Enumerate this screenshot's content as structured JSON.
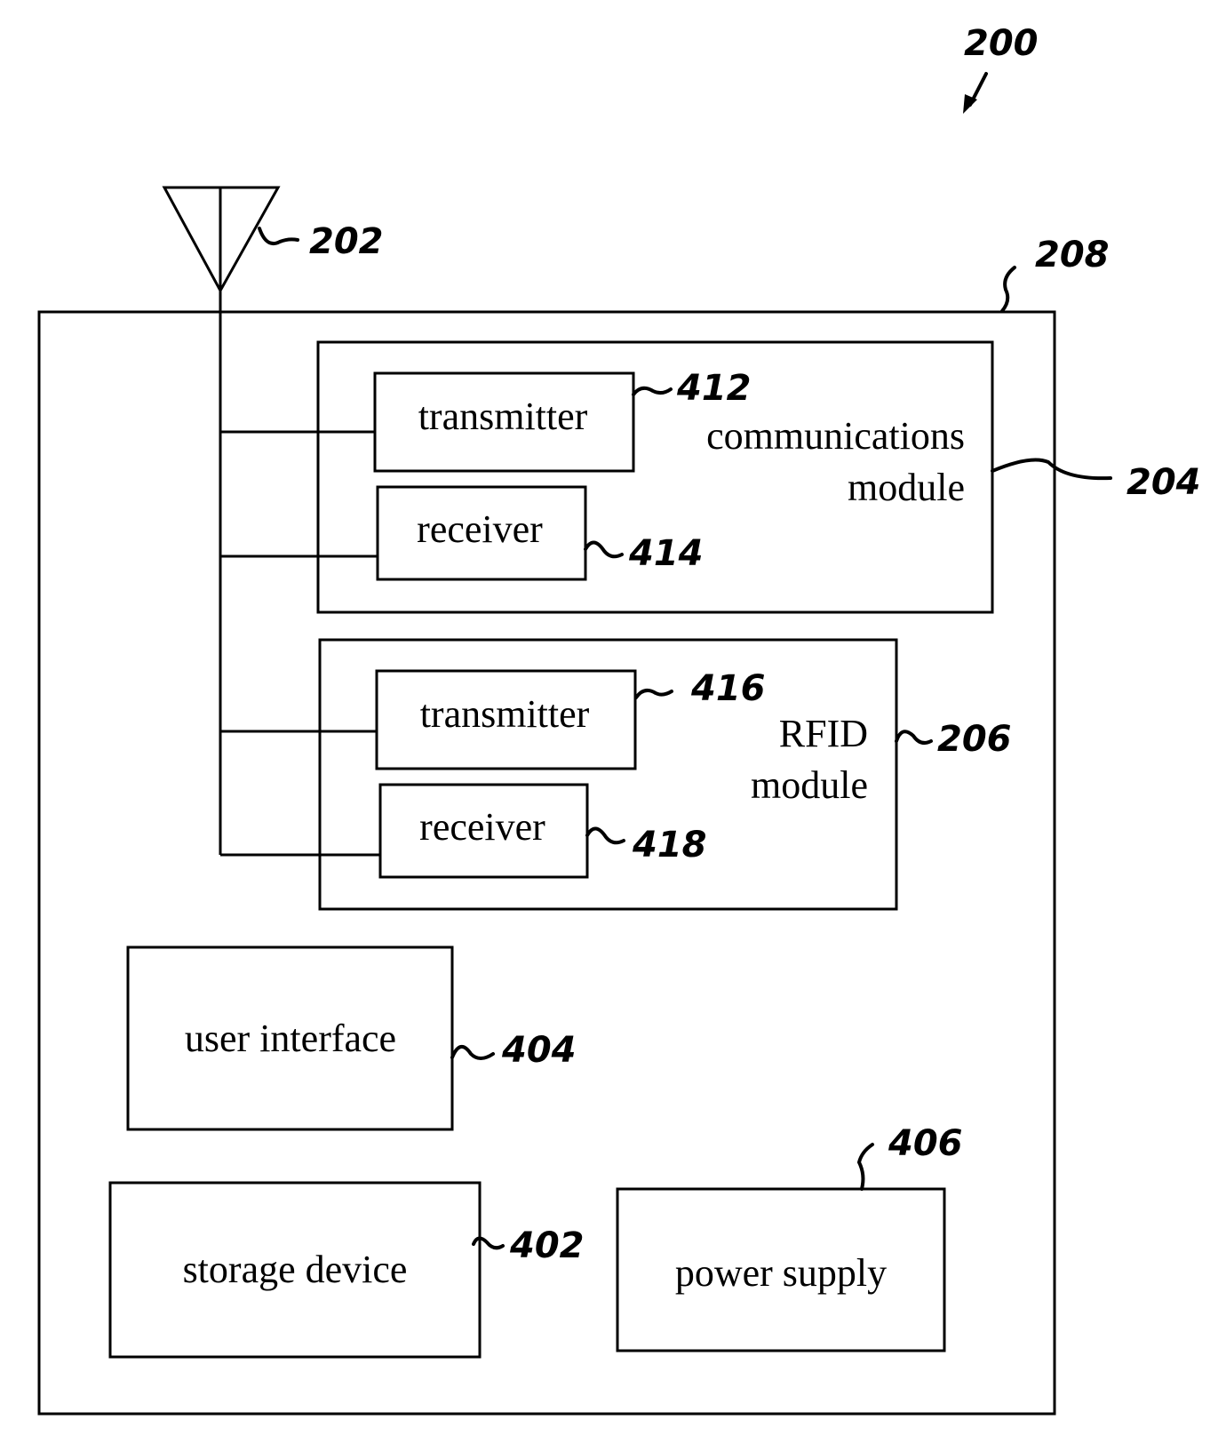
{
  "figure": {
    "ref": "200",
    "ink_color": "#000000",
    "background": "#ffffff"
  },
  "antenna": {
    "ref": "202"
  },
  "housing": {
    "ref": "208"
  },
  "communications_module": {
    "ref": "204",
    "label_line1": "communications",
    "label_line2": "module",
    "transmitter": {
      "label": "transmitter",
      "ref": "412"
    },
    "receiver": {
      "label": "receiver",
      "ref": "414"
    }
  },
  "rfid_module": {
    "ref": "206",
    "label_line1": "RFID",
    "label_line2": "module",
    "transmitter": {
      "label": "transmitter",
      "ref": "416"
    },
    "receiver": {
      "label": "receiver",
      "ref": "418"
    }
  },
  "user_interface": {
    "label": "user interface",
    "ref": "404"
  },
  "storage_device": {
    "label": "storage device",
    "ref": "402"
  },
  "power_supply": {
    "label": "power supply",
    "ref": "406"
  }
}
